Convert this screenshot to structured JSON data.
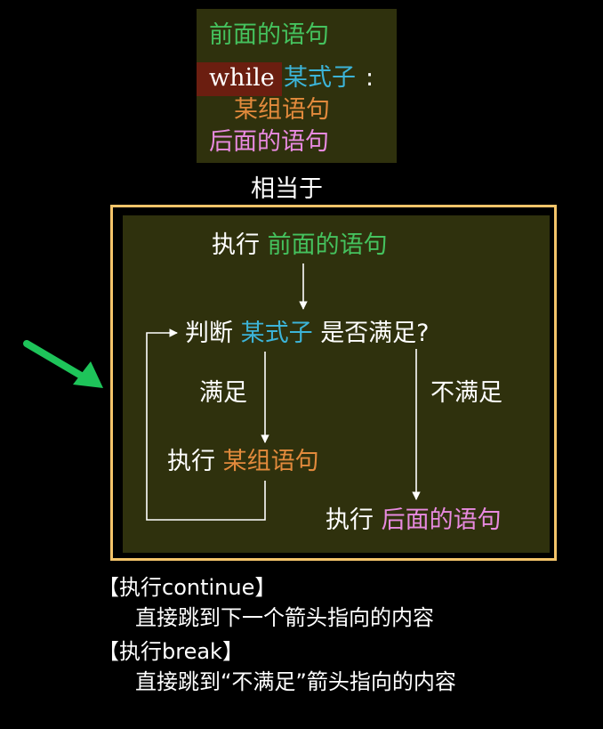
{
  "code": {
    "line1": "前面的语句",
    "keyword": "while",
    "condition": "某式子",
    "colon": ":",
    "body": "某组语句",
    "after": "后面的语句"
  },
  "equivalent": "相当于",
  "flow": {
    "exec1_prefix": "执行",
    "exec1_target": "前面的语句",
    "judge_prefix": "判断",
    "judge_condition": "某式子",
    "judge_suffix": "是否满足?",
    "satisfied": "满足",
    "not_satisfied": "不满足",
    "exec2_prefix": "执行",
    "exec2_target": "某组语句",
    "exec3_prefix": "执行",
    "exec3_target": "后面的语句"
  },
  "notes": {
    "continue_title": "【执行continue】",
    "continue_desc": "直接跳到下一个箭头指向的内容",
    "break_title": "【执行break】",
    "break_desc": "直接跳到“不满足”箭头指向的内容"
  },
  "colors": {
    "green": "#45c25e",
    "cyan": "#3cb4d8",
    "orange": "#e28a3c",
    "pink": "#e88ae0",
    "frame": "#f4c46a",
    "panel": "#2f310d",
    "keyword_bg": "#6b1e10",
    "pointer": "#1ec45a"
  },
  "icons": {
    "pointer": "green-arrow-icon"
  }
}
